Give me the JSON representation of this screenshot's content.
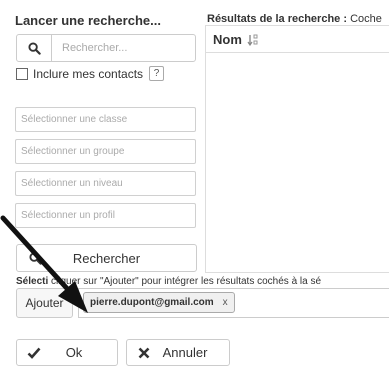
{
  "search_panel": {
    "title": "Lancer une recherche...",
    "search_placeholder": "Rechercher...",
    "include_contacts_label": "Inclure mes contacts",
    "help_badge": "?",
    "selects": [
      {
        "placeholder": "Sélectionner une classe"
      },
      {
        "placeholder": "Sélectionner un groupe"
      },
      {
        "placeholder": "Sélectionner un niveau"
      },
      {
        "placeholder": "Sélectionner un profil"
      }
    ],
    "search_button_label": "Rechercher"
  },
  "results_panel": {
    "title_bold": "Résultats de la recherche :",
    "title_rest": " Coche",
    "column_header": "Nom"
  },
  "selection": {
    "instruction_bold": "Sélecti",
    "instruction_rest": "cliquer sur \"Ajouter\" pour intégrer les résultats cochés à la sé",
    "add_button_label": "Ajouter",
    "tags": [
      {
        "label": "pierre.dupont@gmail.com",
        "remove": "x"
      }
    ]
  },
  "footer": {
    "ok_label": "Ok",
    "cancel_label": "Annuler"
  },
  "icons": {
    "search": "search-icon",
    "sort": "sort-alpha-icon",
    "ok": "check-icon",
    "cancel": "x-icon"
  }
}
